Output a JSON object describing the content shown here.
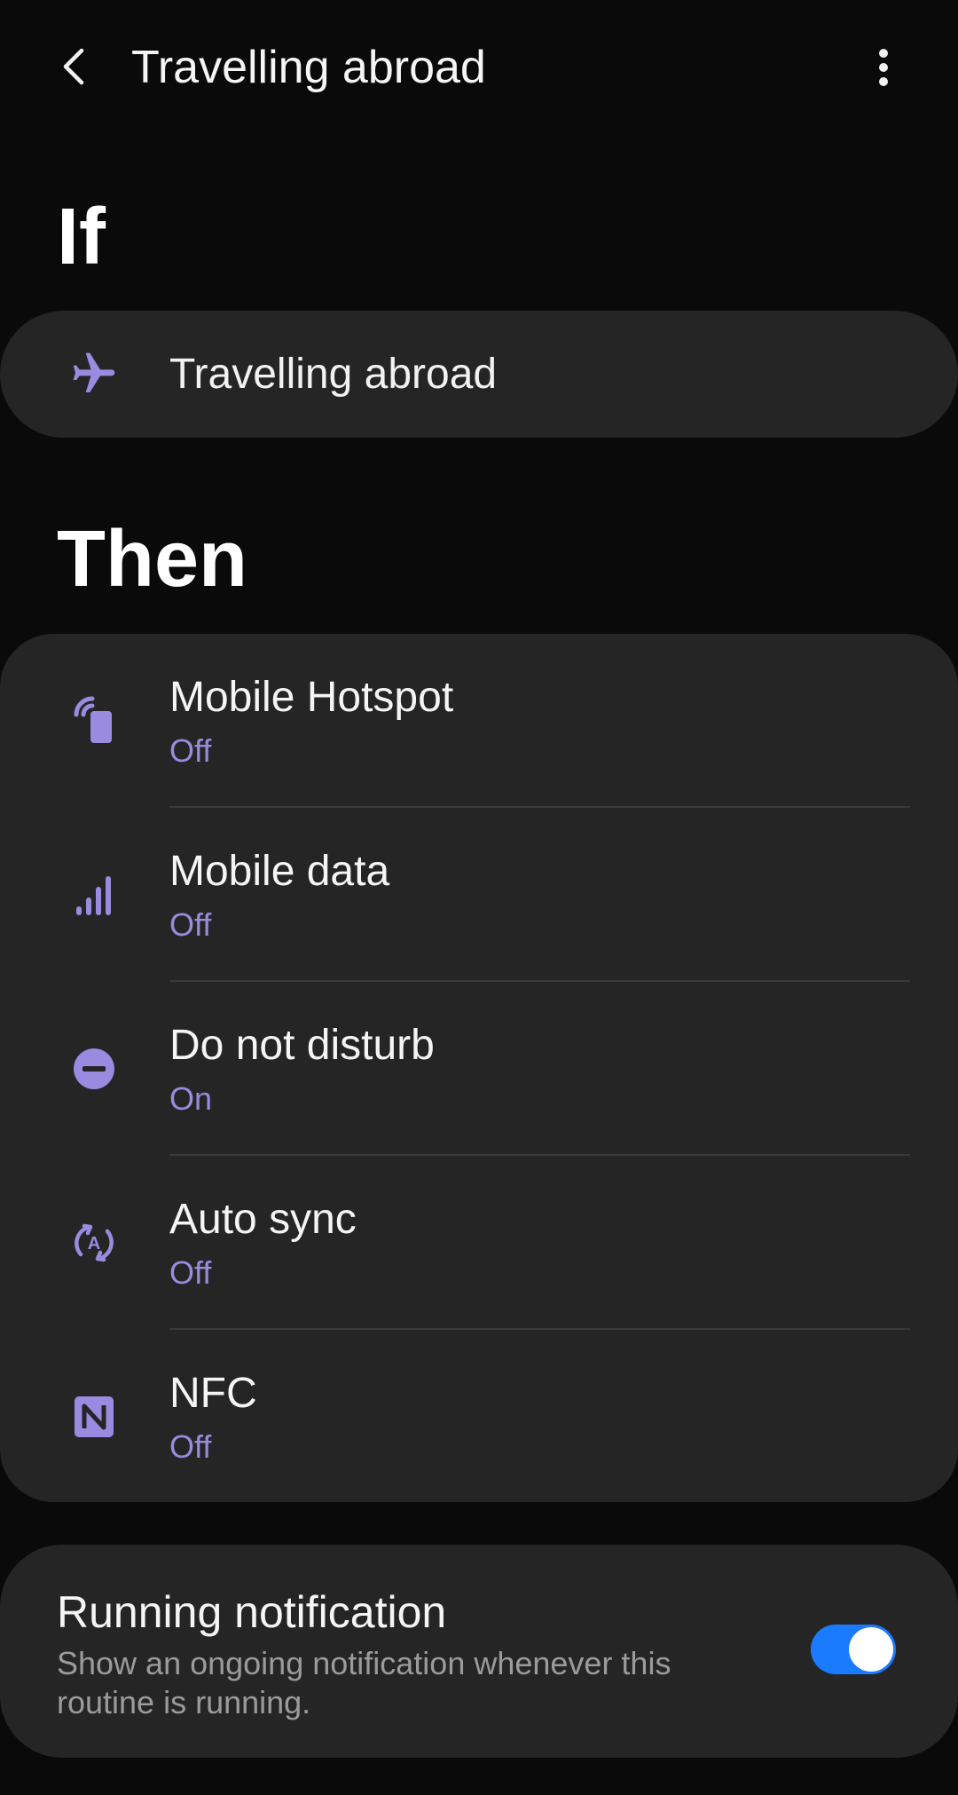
{
  "header": {
    "title": "Travelling abroad",
    "back_icon": "back-arrow-icon",
    "more_icon": "more-options-icon"
  },
  "if_section": {
    "heading": "If",
    "condition": {
      "icon": "airplane-icon",
      "label": "Travelling abroad"
    }
  },
  "then_section": {
    "heading": "Then",
    "actions": [
      {
        "icon": "hotspot-icon",
        "title": "Mobile Hotspot",
        "status": "Off"
      },
      {
        "icon": "signal-bars-icon",
        "title": "Mobile data",
        "status": "Off"
      },
      {
        "icon": "do-not-disturb-icon",
        "title": "Do not disturb",
        "status": "On"
      },
      {
        "icon": "auto-sync-icon",
        "title": "Auto sync",
        "status": "Off"
      },
      {
        "icon": "nfc-icon",
        "title": "NFC",
        "status": "Off"
      }
    ]
  },
  "running_notification": {
    "title": "Running notification",
    "description": "Show an ongoing notification whenever this routine is running.",
    "enabled": true
  },
  "colors": {
    "background": "#0a0a0a",
    "card": "#252525",
    "accent": "#9a8ae0",
    "toggle_on": "#1a7bff"
  }
}
